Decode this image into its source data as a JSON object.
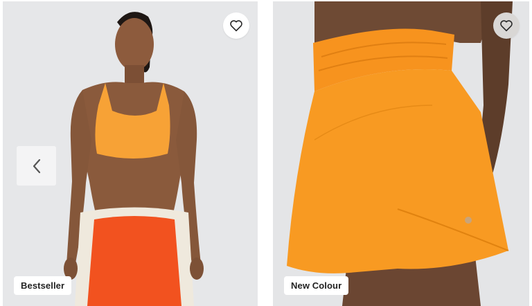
{
  "products": [
    {
      "badge": "Bestseller",
      "image": "model wearing orange sports bra and red shorts",
      "favorite_icon": "heart-outline-icon",
      "prev_icon": "chevron-left-icon"
    },
    {
      "badge": "New Colour",
      "image": "close-up of orange running shorts",
      "favorite_icon": "heart-outline-icon"
    }
  ],
  "colors": {
    "card_background": "#e6e7e9",
    "badge_background": "#ffffff",
    "badge_text": "#222222",
    "orange": "#f7931e",
    "red_orange": "#f2521f"
  }
}
